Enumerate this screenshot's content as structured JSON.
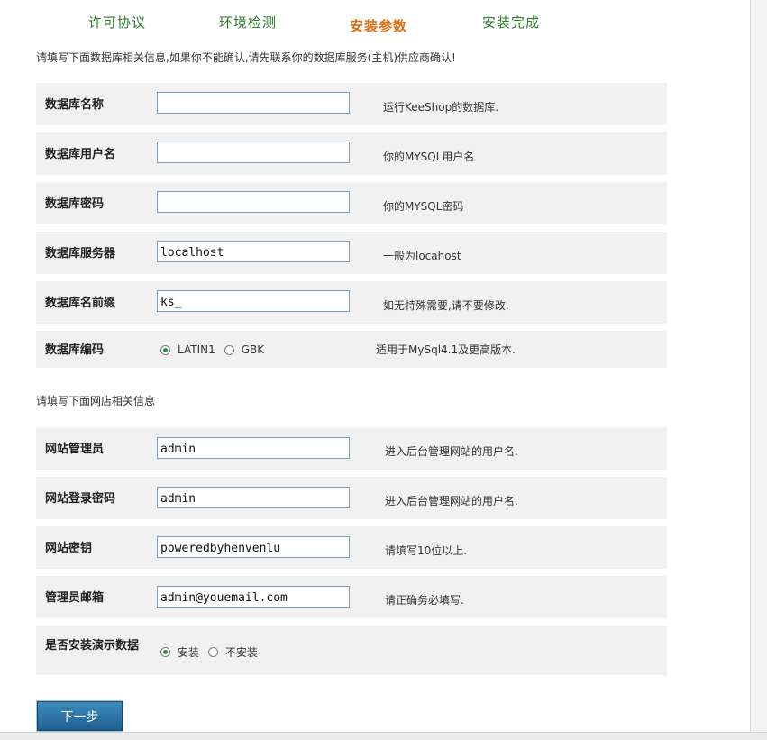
{
  "steps": [
    {
      "label": "许可协议",
      "active": false
    },
    {
      "label": "环境检测",
      "active": false
    },
    {
      "label": "安装参数",
      "active": true
    },
    {
      "label": "安装完成",
      "active": false
    }
  ],
  "db_note": "请填写下面数据库相关信息,如果你不能确认,请先联系你的数据库服务(主机)供应商确认!",
  "db_fields": [
    {
      "label": "数据库名称",
      "value": "",
      "hint": "运行KeeShop的数据库."
    },
    {
      "label": "数据库用户名",
      "value": "",
      "hint": "你的MYSQL用户名"
    },
    {
      "label": "数据库密码",
      "value": "",
      "hint": "你的MYSQL密码"
    },
    {
      "label": "数据库服务器",
      "value": "localhost",
      "hint": "一般为locahost"
    },
    {
      "label": "数据库名前缀",
      "value": "ks_",
      "hint": "如无特殊需要,请不要修改."
    }
  ],
  "db_encoding": {
    "label": "数据库编码",
    "options": [
      "LATIN1",
      "GBK"
    ],
    "selected": "LATIN1",
    "hint": "适用于MySql4.1及更高版本."
  },
  "shop_note": "请填写下面网店相关信息",
  "shop_fields": [
    {
      "label": "网站管理员",
      "value": "admin",
      "hint": "进入后台管理网站的用户名."
    },
    {
      "label": "网站登录密码",
      "value": "admin",
      "hint": "进入后台管理网站的用户名."
    },
    {
      "label": "网站密钥",
      "value": "poweredbyhenvenlu",
      "hint": "请填写10位以上."
    },
    {
      "label": "管理员邮箱",
      "value": "admin@youemail.com",
      "hint": "请正确务必填写."
    }
  ],
  "demo_data": {
    "label": "是否安装演示数据",
    "options": [
      "安装",
      "不安装"
    ],
    "selected": "安装"
  },
  "next_button": "下一步"
}
